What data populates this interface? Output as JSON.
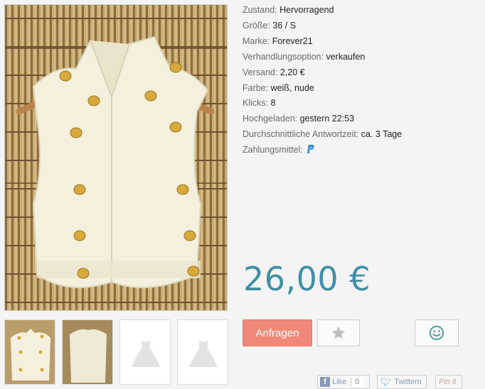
{
  "details": [
    {
      "label": "Zustand:",
      "value": "Hervorragend"
    },
    {
      "label": "Größe:",
      "value": "36 / S"
    },
    {
      "label": "Marke:",
      "value": "Forever21"
    },
    {
      "label": "Verhandlungsoption:",
      "value": "verkaufen"
    },
    {
      "label": "Versand:",
      "value": "2,20 €"
    },
    {
      "label": "Farbe:",
      "value": "weiß, nude"
    },
    {
      "label": "Klicks:",
      "value": "8"
    },
    {
      "label": "Hochgeladen:",
      "value": "gestern 22:53"
    },
    {
      "label": "Durchschnittliche Antwortzeit:",
      "value": "ca. 3 Tage"
    },
    {
      "label": "Zahlungsmittel:",
      "value": "",
      "icon": "paypal-icon"
    }
  ],
  "price": "26,00 €",
  "actions": {
    "ask_label": "Anfragen",
    "favorite_icon": "star-icon",
    "smile_icon": "smiley-icon"
  },
  "social": {
    "facebook_label": "Like",
    "facebook_count": "0",
    "twitter_label": "Twittern",
    "pinterest_label": "Pin it"
  },
  "colors": {
    "price": "#3e8fa6",
    "ask_button": "#f08878",
    "paypal": "#2b77c5"
  }
}
